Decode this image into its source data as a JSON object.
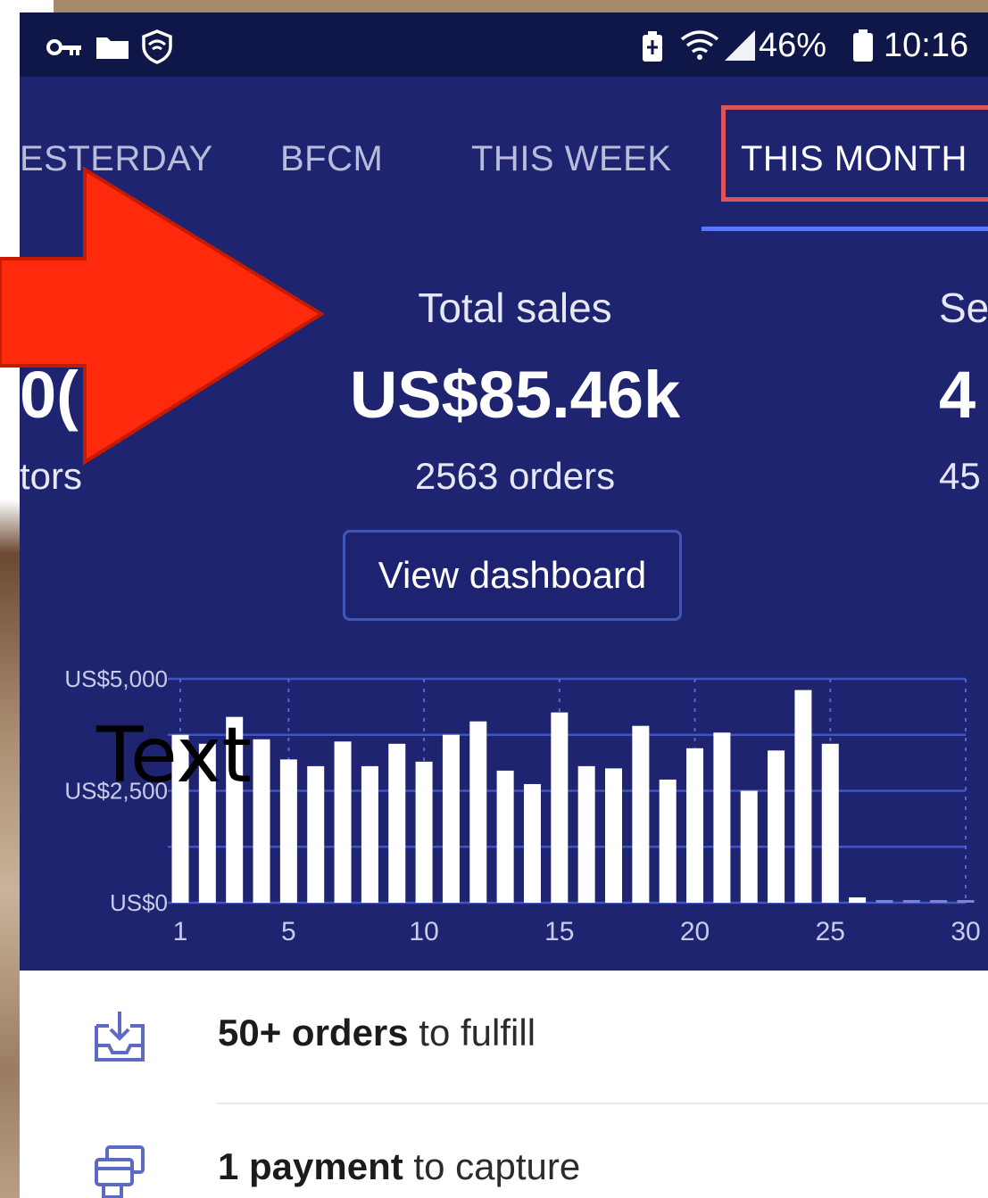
{
  "status_bar": {
    "battery_percent": "46%",
    "time": "10:16",
    "icons": [
      "key-icon",
      "folder-icon",
      "vpn-shield-icon",
      "battery-saver-icon",
      "wifi-icon",
      "signal-icon",
      "battery-icon"
    ]
  },
  "tabs": {
    "items": [
      {
        "label": "ESTERDAY"
      },
      {
        "label": "BFCM"
      },
      {
        "label": "THIS WEEK"
      },
      {
        "label": "THIS MONTH"
      }
    ],
    "active_index": 3
  },
  "metrics": {
    "main": {
      "label": "Total sales",
      "value": "US$85.46k",
      "sub": "2563 orders"
    },
    "left_partial": {
      "value": "0(",
      "sub": "tors"
    },
    "right_partial": {
      "label": "Se",
      "value": "4",
      "sub": "45"
    }
  },
  "view_dashboard_label": "View dashboard",
  "chart_data": {
    "type": "bar",
    "y_tick_labels": [
      "US$5,000",
      "US$2,500",
      "US$0"
    ],
    "x_tick_labels": [
      "1",
      "5",
      "10",
      "15",
      "20",
      "25",
      "30"
    ],
    "ylim": [
      0,
      5000
    ],
    "xlim": [
      1,
      30
    ],
    "categories": [
      1,
      2,
      3,
      4,
      5,
      6,
      7,
      8,
      9,
      10,
      11,
      12,
      13,
      14,
      15,
      16,
      17,
      18,
      19,
      20,
      21,
      22,
      23,
      24,
      25,
      26,
      27,
      28,
      29,
      30
    ],
    "values": [
      3750,
      3550,
      4150,
      3650,
      3200,
      3050,
      3600,
      3050,
      3550,
      3150,
      3750,
      4050,
      2950,
      2650,
      4250,
      3050,
      3000,
      3950,
      2750,
      3450,
      3800,
      2500,
      3400,
      4750,
      3550,
      120,
      60,
      60,
      60,
      60
    ],
    "bar_color": "#ffffff",
    "grid": true
  },
  "overlay": {
    "text": "Text",
    "arrow_color": "#ff2a0c"
  },
  "checklist": [
    {
      "icon": "inbox-download-icon",
      "bold": "50+ orders",
      "rest": " to fulfill"
    },
    {
      "icon": "payment-card-icon",
      "bold": "1 payment",
      "rest": " to capture"
    }
  ]
}
